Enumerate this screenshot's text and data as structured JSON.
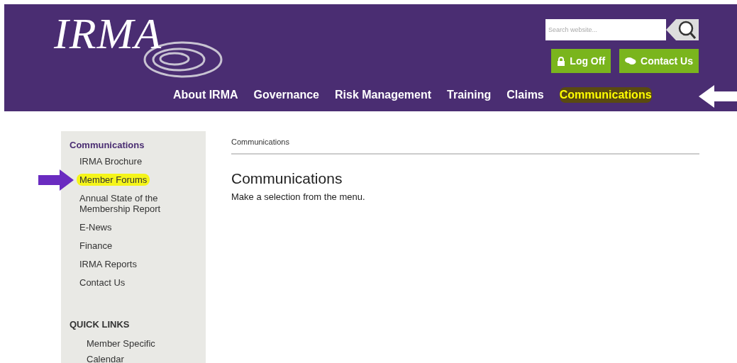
{
  "header": {
    "logo": "IRMA",
    "search": {
      "placeholder": "Search website..."
    },
    "buttons": [
      {
        "label": "Log Off",
        "kind": "lock"
      },
      {
        "label": "Contact Us",
        "kind": "chat"
      }
    ],
    "nav": [
      {
        "label": "About IRMA",
        "highlighted": false
      },
      {
        "label": "Governance",
        "highlighted": false
      },
      {
        "label": "Risk Management",
        "highlighted": false
      },
      {
        "label": "Training",
        "highlighted": false
      },
      {
        "label": "Claims",
        "highlighted": false
      },
      {
        "label": "Communications",
        "highlighted": true
      }
    ]
  },
  "sidebar": {
    "title": "Communications",
    "items": [
      {
        "label": "IRMA Brochure",
        "highlighted": false
      },
      {
        "label": "Member Forums",
        "highlighted": true
      },
      {
        "label": "Annual State of the Membership Report",
        "highlighted": false
      },
      {
        "label": "E-News",
        "highlighted": false
      },
      {
        "label": "Finance",
        "highlighted": false
      },
      {
        "label": "IRMA Reports",
        "highlighted": false
      },
      {
        "label": "Contact Us",
        "highlighted": false
      }
    ],
    "quick_links_title": "QUICK LINKS",
    "quick_links": [
      "Member Specific",
      "Calendar"
    ]
  },
  "content": {
    "breadcrumb": "Communications",
    "heading": "Communications",
    "text": "Make a selection from the menu."
  }
}
